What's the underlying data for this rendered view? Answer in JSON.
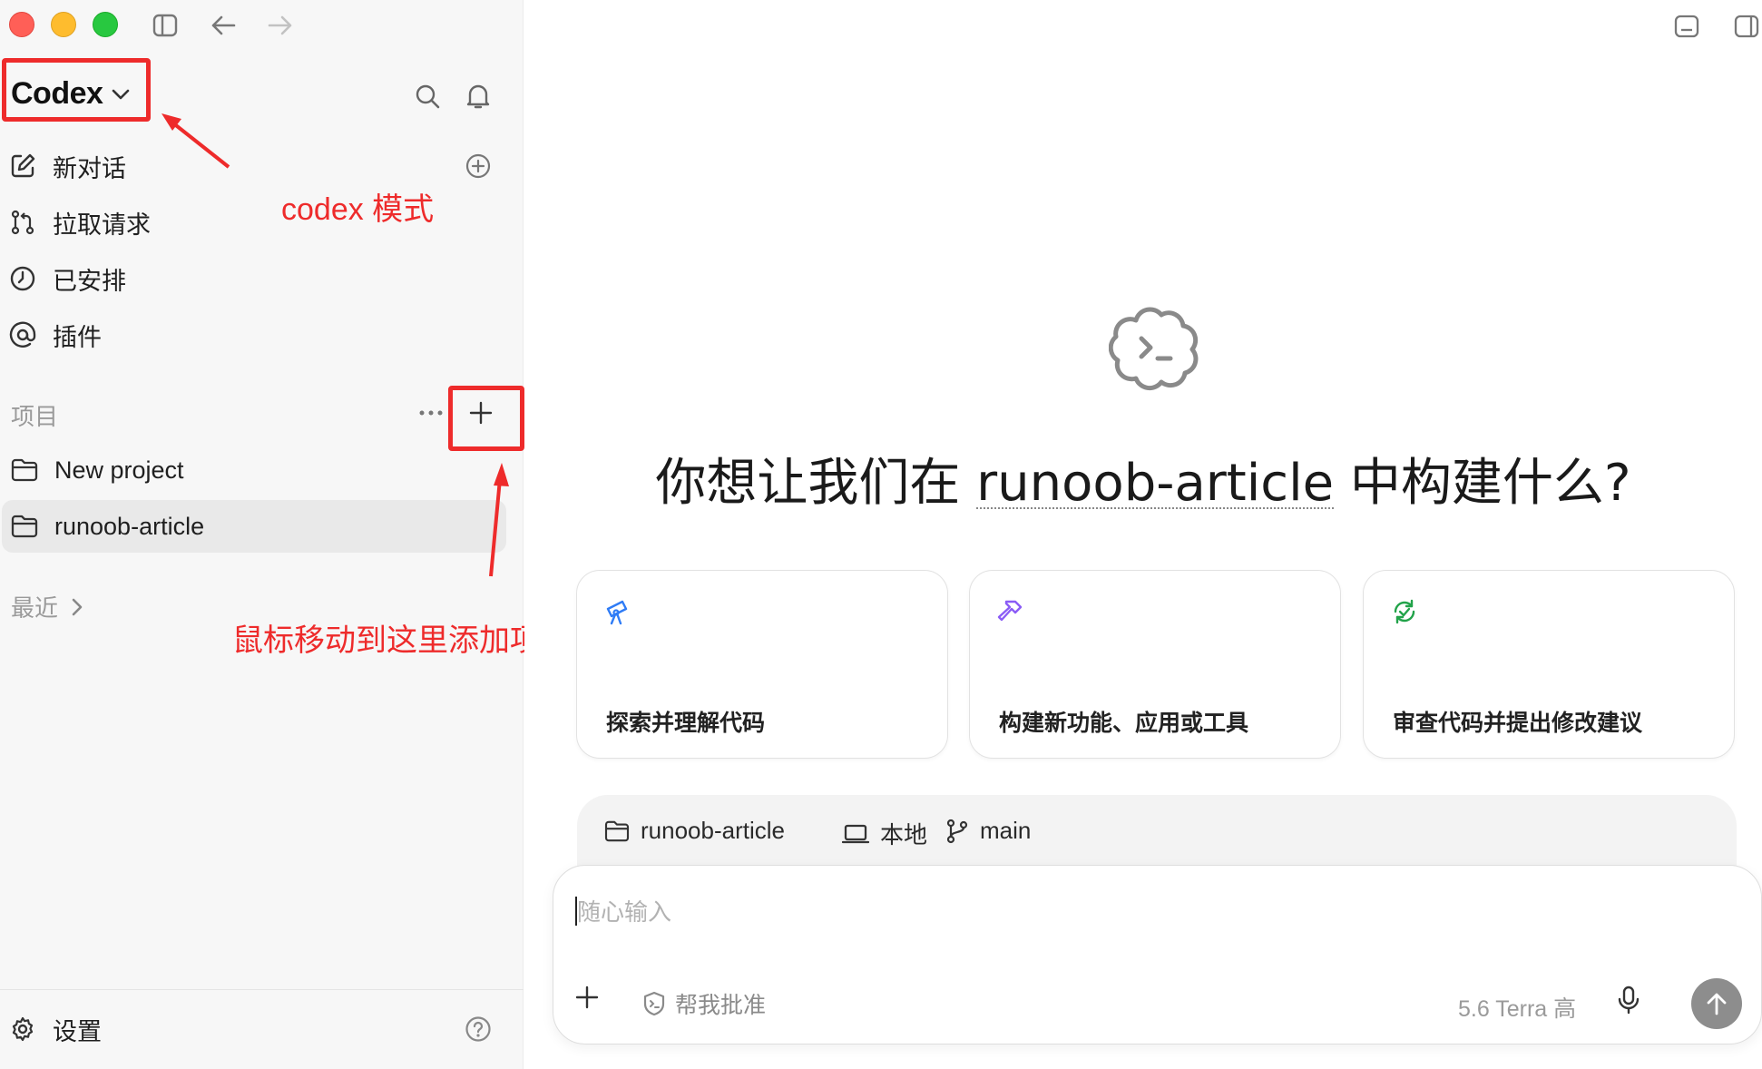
{
  "sidebar": {
    "brand": {
      "name": "Codex"
    },
    "nav": [
      {
        "label": "新对话",
        "icon": "edit-icon"
      },
      {
        "label": "拉取请求",
        "icon": "pull-request-icon"
      },
      {
        "label": "已安排",
        "icon": "clock-icon"
      },
      {
        "label": "插件",
        "icon": "at-icon"
      }
    ],
    "projects_label": "项目",
    "projects": [
      {
        "name": "New project",
        "active": false
      },
      {
        "name": "runoob-article",
        "active": true
      }
    ],
    "recent_label": "最近",
    "settings_label": "设置"
  },
  "annotations": {
    "codex_mode": "codex 模式",
    "add_project_hint": "鼠标移动到这里添加项目",
    "highlight_color": "#ee2b2b"
  },
  "main": {
    "title_prefix": "你想让我们在 ",
    "project_name": "runoob-article",
    "title_suffix": " 中构建什么?",
    "cards": [
      {
        "label": "探索并理解代码",
        "icon": "telescope-icon",
        "color": "#2f7cf6"
      },
      {
        "label": "构建新功能、应用或工具",
        "icon": "hammer-icon",
        "color": "#8b5cf6"
      },
      {
        "label": "审查代码并提出修改建议",
        "icon": "review-icon",
        "color": "#22a34a"
      }
    ],
    "context": {
      "project": "runoob-article",
      "environment": "本地",
      "branch": "main"
    },
    "composer": {
      "placeholder": "随心输入",
      "approve_label": "帮我批准",
      "model_label": "5.6 Terra 高"
    }
  }
}
